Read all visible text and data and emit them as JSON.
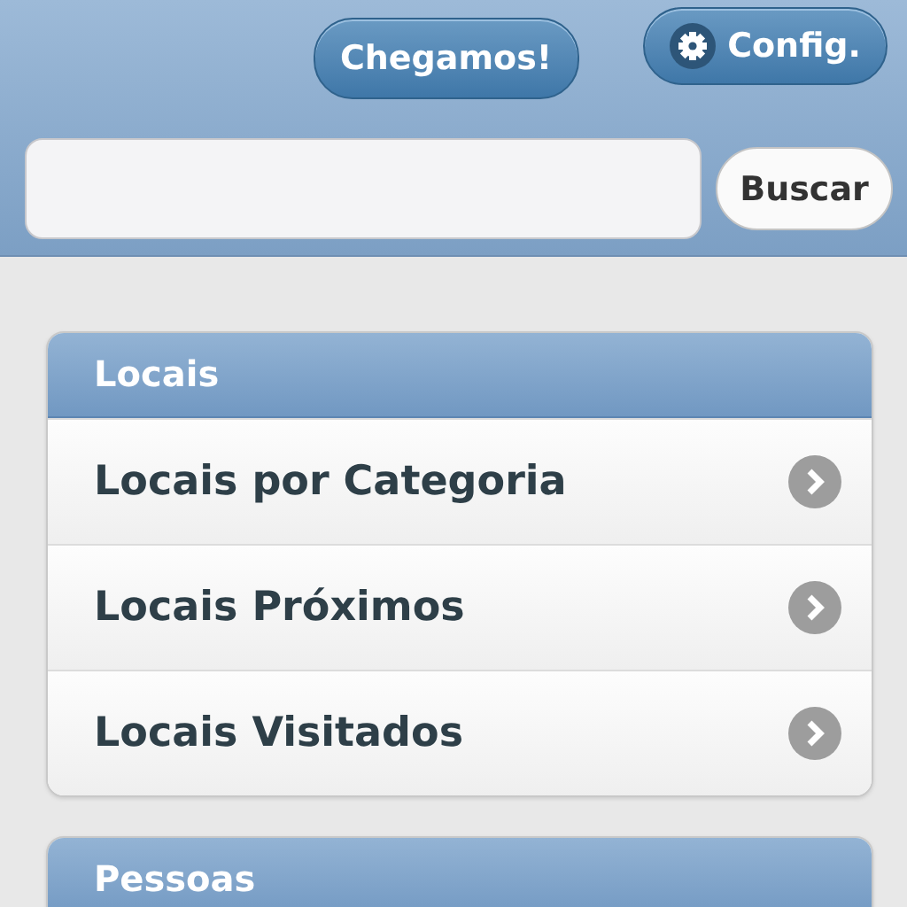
{
  "header": {
    "buttons": [
      {
        "label": "Chegamos!",
        "kind": "plain"
      },
      {
        "label": "Config.",
        "kind": "gear"
      }
    ],
    "search": {
      "button": "Buscar"
    }
  },
  "sections": [
    {
      "title": "Locais",
      "items": [
        "Locais por Categoria",
        "Locais Próximos",
        "Locais Visitados"
      ]
    },
    {
      "title": "Pessoas"
    }
  ]
}
